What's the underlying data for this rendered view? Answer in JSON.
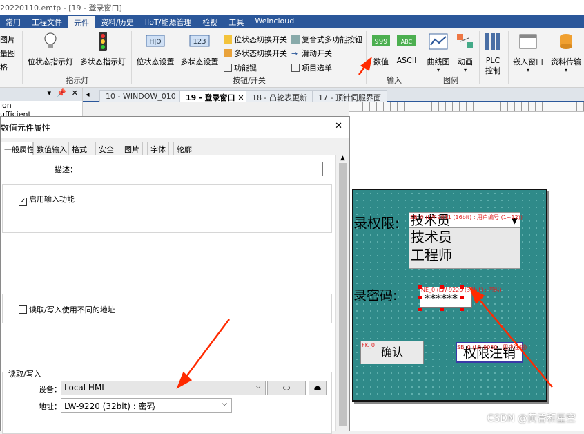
{
  "window_title": "20220110.emtp - [19 - 登录窗口]",
  "menu": [
    "常用",
    "工程文件",
    "元件",
    "资料/历史",
    "IIoT/能源管理",
    "检视",
    "工具",
    "Weincloud"
  ],
  "ribbon": {
    "left_cut": [
      "图片",
      "量图",
      "格"
    ],
    "indicator": {
      "bit_lamp": "位状态指示灯",
      "multi_lamp": "多状态指示灯",
      "group": "指示灯"
    },
    "buttons": {
      "bit_set": "位状态设置",
      "multi_set": "多状态设置",
      "bit_switch": "位状态切换开关",
      "multi_switch": "多状态切换开关",
      "function_key": "功能键",
      "combo": "复合式多功能按钮",
      "slider": "滑动开关",
      "item_select": "项目选单",
      "group": "按钮/开关"
    },
    "input": {
      "numeric": "数值",
      "ascii": "ASCII",
      "group": "输入"
    },
    "chart": {
      "trend": "曲线图",
      "anim": "动画",
      "group": "图例"
    },
    "plc": "PLC 控制",
    "embed": "嵌入窗口",
    "transfer": "资料传输"
  },
  "doc_tabs": [
    "10 - WINDOW_010",
    "19 - 登录窗口",
    "18 - 凸轮表更新",
    "17 - 顶针伺服界面"
  ],
  "left_panel": [
    "ion",
    "ufficient"
  ],
  "dialog": {
    "title": "数值元件属性",
    "tabs": [
      "一般属性",
      "数值输入",
      "格式",
      "安全",
      "图片",
      "字体",
      "轮廓"
    ],
    "desc_label": "描述：",
    "desc_value": "",
    "enable_input": "启用输入功能",
    "diff_addr": "读取/写入使用不同的地址",
    "rw_section": "读取/写入",
    "device_label": "设备：",
    "device_value": "Local HMI",
    "addr_label": "地址：",
    "addr_value": "LW-9220 (32bit) : 密码"
  },
  "hmi": {
    "perm_label": "录权限:",
    "perm_options": [
      "技术员",
      "技术员",
      "工程师"
    ],
    "perm_tag": "SB_0 (LW-9011 (16bit) : 用户编号 (1~12))",
    "pwd_label": "录密码:",
    "pwd_value": "******",
    "pwd_tag": "NE_0 (LW-9220 (32bit) : 密码)",
    "fk_tag": "FK_0",
    "confirm": "确认",
    "logout_tag": "SB_0 (LB-9050 : 用户注销)",
    "logout": "权限注销"
  },
  "watermark": "CSDN @黄昏和星空",
  "colors": {
    "accent": "#2b579a",
    "hmi_bg": "#2f8a89",
    "annotation": "#e02020"
  }
}
